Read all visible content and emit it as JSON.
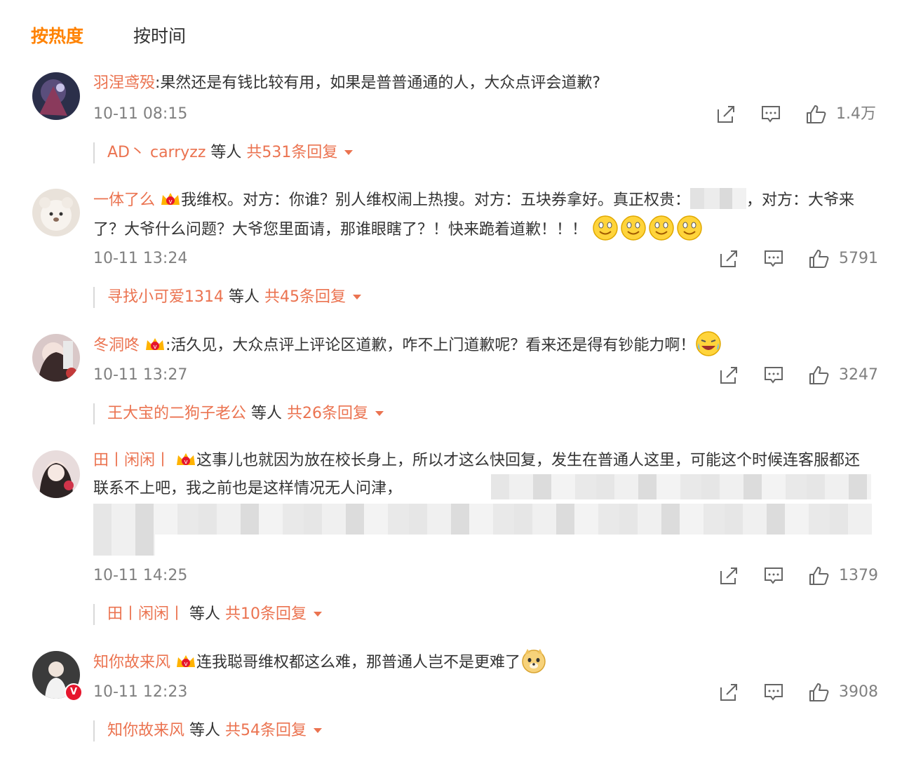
{
  "tabs": [
    {
      "label": "按热度",
      "active": true
    },
    {
      "label": "按时间",
      "active": false
    }
  ],
  "comments": [
    {
      "user": "羽涅鸢殁",
      "text": ":果然还是有钱比较有用，如果是普普通通的人，大众点评会道歉?",
      "time": "10-11 08:15",
      "likes": "1.4万",
      "reply_names": "AD丶 carryzz",
      "reply_mid": " 等人 ",
      "reply_total": "共531条回复"
    },
    {
      "user": "一体了么",
      "text_a": "我维权。对方：你谁？别人维权闹上热搜。对方：五块券拿好。真正权贵：",
      "text_b": "，对方：大爷来了？大爷什么问题？大爷您里面请，那谁眼瞎了？！快来跪着道歉！！！",
      "emojis": [
        "smile-emoji",
        "smile-emoji",
        "smile-emoji",
        "smile-emoji"
      ],
      "time": "10-11 13:24",
      "likes": "5791",
      "reply_names": "寻找小可爱1314",
      "reply_mid": " 等人 ",
      "reply_total": "共45条回复"
    },
    {
      "user": "冬洞咚",
      "text": ":活久见，大众点评上评论区道歉，咋不上门道歉呢？看来还是得有钞能力啊！",
      "time": "10-11 13:27",
      "likes": "3247",
      "reply_names": "王大宝的二狗子老公",
      "reply_mid": " 等人 ",
      "reply_total": "共26条回复"
    },
    {
      "user": "田丨闲闲丨",
      "text": "这事儿也就因为放在校长身上，所以才这么快回复，发生在普通人这里，可能这个时候连客服都还联系不上吧，我之前也是这样情况无人问津，",
      "time": "10-11 14:25",
      "likes": "1379",
      "reply_names": "田丨闲闲丨",
      "reply_mid": " 等人 ",
      "reply_total": "共10条回复"
    },
    {
      "user": "知你故来风",
      "text": "连我聪哥维权都这么难，那普通人岂不是更难了",
      "verified": "V",
      "time": "10-11 12:23",
      "likes": "3908",
      "reply_names": "知你故来风",
      "reply_mid": " 等人 ",
      "reply_total": "共54条回复"
    }
  ],
  "colors": {
    "accent": "#ff8200",
    "username": "#eb7350",
    "meta": "#808080",
    "text": "#333333"
  }
}
